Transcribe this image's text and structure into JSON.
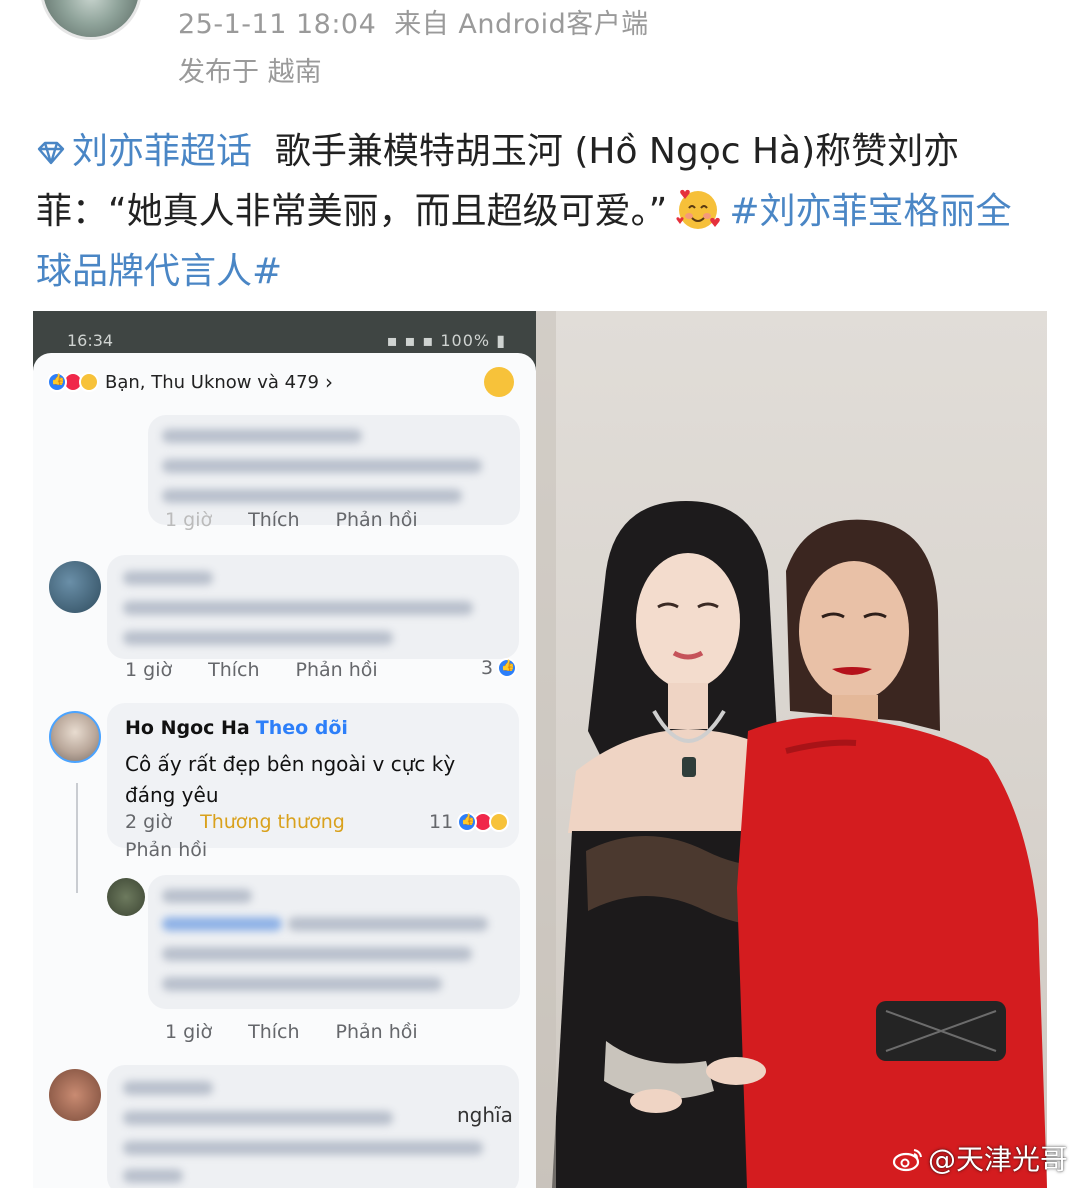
{
  "post": {
    "timestamp": "25-1-11 18:04",
    "source": "来自 Android客户端",
    "location": "发布于 越南",
    "topic": "刘亦菲超话",
    "text_part1": "歌手兼模特胡玉河 (Hồ Ngọc Hà)称赞刘亦菲：“她真人非常美丽，而且超级可爱。”",
    "hashtag": "#刘亦菲宝格丽全球品牌代言人#"
  },
  "screenshot": {
    "status_time": "16:34",
    "status_right": "100%",
    "reactions_summary": "Bạn, Thu Uknow và 479",
    "comments": [
      {
        "time": "1 giờ",
        "like": "Thích",
        "reply": "Phản hồi"
      },
      {
        "time": "1 giờ",
        "like": "Thích",
        "reply": "Phản hồi",
        "count": "3"
      },
      {
        "author": "Ho Ngoc Ha",
        "follow": "Theo dõi",
        "text": "Cô ấy rất đẹp bên ngoài v cực kỳ đáng yêu",
        "time": "2 giờ",
        "reaction": "Thương thương",
        "count": "11",
        "reply": "Phản hồi"
      },
      {
        "time": "1 giờ",
        "like": "Thích",
        "reply": "Phản hồi"
      },
      {
        "visible_fragment": "nghĩa"
      }
    ]
  },
  "watermark": "@天津光哥",
  "colors": {
    "link": "#4a86c5",
    "meta": "#9a9a9a",
    "fb_blue": "#2d7ff9",
    "red_dress": "#d41c1f"
  }
}
